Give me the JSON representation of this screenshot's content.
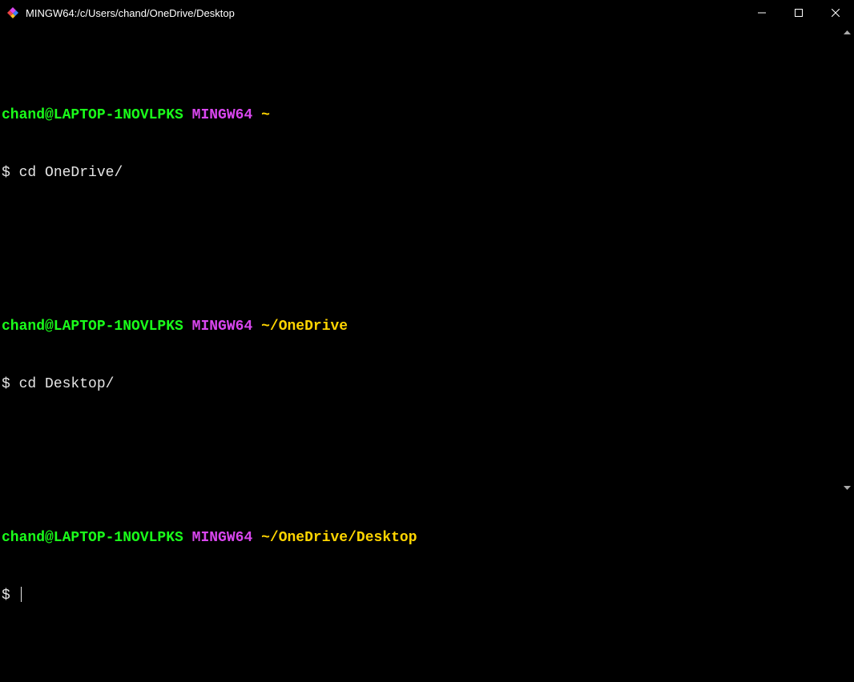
{
  "titlebar": {
    "title": "MINGW64:/c/Users/chand/OneDrive/Desktop"
  },
  "blocks": [
    {
      "user": "chand@LAPTOP-1NOVLPKS",
      "env": "MINGW64",
      "path": "~",
      "dollar": "$",
      "command": "cd OneDrive/"
    },
    {
      "user": "chand@LAPTOP-1NOVLPKS",
      "env": "MINGW64",
      "path": "~/OneDrive",
      "dollar": "$",
      "command": "cd Desktop/"
    },
    {
      "user": "chand@LAPTOP-1NOVLPKS",
      "env": "MINGW64",
      "path": "~/OneDrive/Desktop",
      "dollar": "$",
      "command": ""
    }
  ]
}
